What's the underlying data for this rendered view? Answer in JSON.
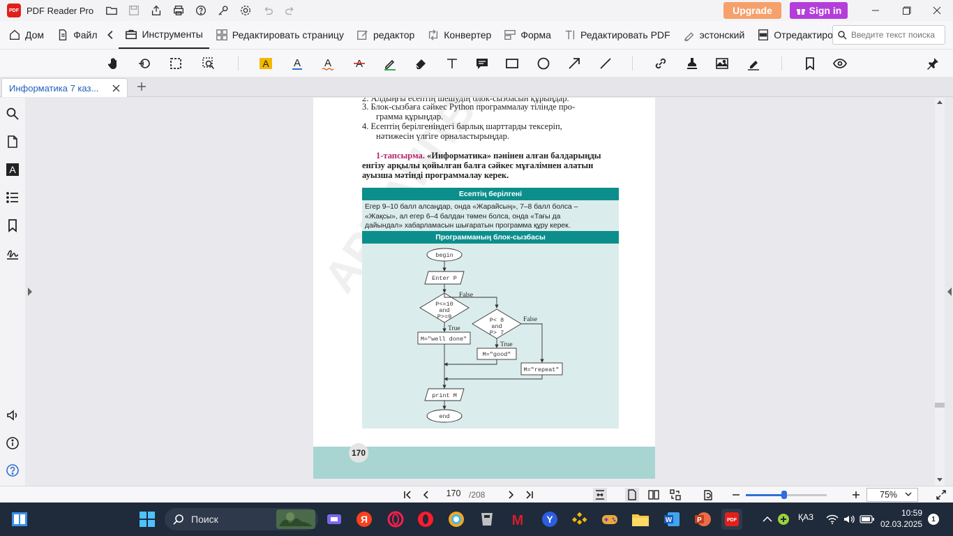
{
  "app": {
    "name": "PDF Reader Pro",
    "logo_text": "PDF"
  },
  "title_buttons": {
    "upgrade": "Upgrade",
    "signin": "Sign in"
  },
  "menu": {
    "items": [
      {
        "id": "home",
        "label": "Дом",
        "icon": "home-icon"
      },
      {
        "id": "file",
        "label": "Файл",
        "icon": "file-icon"
      },
      {
        "id": "tools",
        "label": "Инструменты",
        "icon": "toolbox-icon",
        "active": true
      },
      {
        "id": "edit-page",
        "label": "Редактировать страницу",
        "icon": "grid-icon"
      },
      {
        "id": "editor",
        "label": "редактор",
        "icon": "edit-icon"
      },
      {
        "id": "converter",
        "label": "Конвертер",
        "icon": "convert-icon"
      },
      {
        "id": "form",
        "label": "Форма",
        "icon": "form-icon"
      },
      {
        "id": "edit-pdf",
        "label": "Редактировать PDF",
        "icon": "text-edit-icon"
      },
      {
        "id": "estonian",
        "label": "эстонский",
        "icon": "sign-icon"
      },
      {
        "id": "redact",
        "label": "Отредактировать",
        "icon": "redact-icon"
      }
    ],
    "search_placeholder": "Введите текст поиска"
  },
  "tab": {
    "title": "Информатика 7 каз..."
  },
  "page_content": {
    "list_top_partial": "2.  Алдыңғы есептің шешудің блок-сызбасын құрыңдар.",
    "list_item_3_a": "3.  Блок-сызбаға сәйкес Python программалау тілінде про-",
    "list_item_3_b": "грамма құрыңдар.",
    "list_item_4_a": "4.  Есептің берілгеніндегі барлық шарттарды тексеріп,",
    "list_item_4_b": "нәтижесін үлгіге орналастырыңдар.",
    "task_lead": "1-тапсырма.",
    "task_line_1": "«Информатика» пәнінен алған балдарыңды",
    "task_line_2": "енгізу арқылы қойылған балға сәйкес мұғалімнен алатын",
    "task_line_3": "ауызша мәтінді программалау керек.",
    "box_header_1": "Есептің берілгені",
    "box_text_1": "Егер 9–10 балл алсаңдар, онда «Жарайсың», 7–8 балл болса –",
    "box_text_2": "«Жақсы», ал егер 6–4 балдан төмен болса, онда «Тағы да",
    "box_text_3": "дайындал» хабарламасын шығаратын программа құру керек.",
    "box_header_2": "Программаның блок-сызбасы",
    "watermark": "АРМАНПВ.РФ",
    "page_number": "170"
  },
  "flowchart": {
    "begin": "begin",
    "input": "Enter P",
    "cond1": [
      "P<=10",
      "and",
      "P>=9"
    ],
    "cond2": [
      "P< 8",
      "and",
      "P> 7"
    ],
    "false1": "False",
    "true1": "True",
    "false2": "False",
    "true2": "True",
    "assign1": "M=\"well done\"",
    "assign2": "M=\"good\"",
    "assign3": "M=\"repeat\"",
    "print": "print M",
    "end": "end"
  },
  "status": {
    "current_page": "170",
    "total_pages": "/208",
    "zoom": "75%",
    "zoom_fraction": 0.47
  },
  "taskbar": {
    "search_label": "Поиск",
    "lang": "ҚАЗ",
    "time": "10:59",
    "date": "02.03.2025",
    "notifications": "1"
  },
  "colors": {
    "teal_header": "#0c8f8c",
    "teal_body": "#dbecec",
    "lead_color": "#b2236f",
    "upgrade": "#f6a06b",
    "signin": "#b43ed9",
    "accent": "#2f6fd8"
  }
}
